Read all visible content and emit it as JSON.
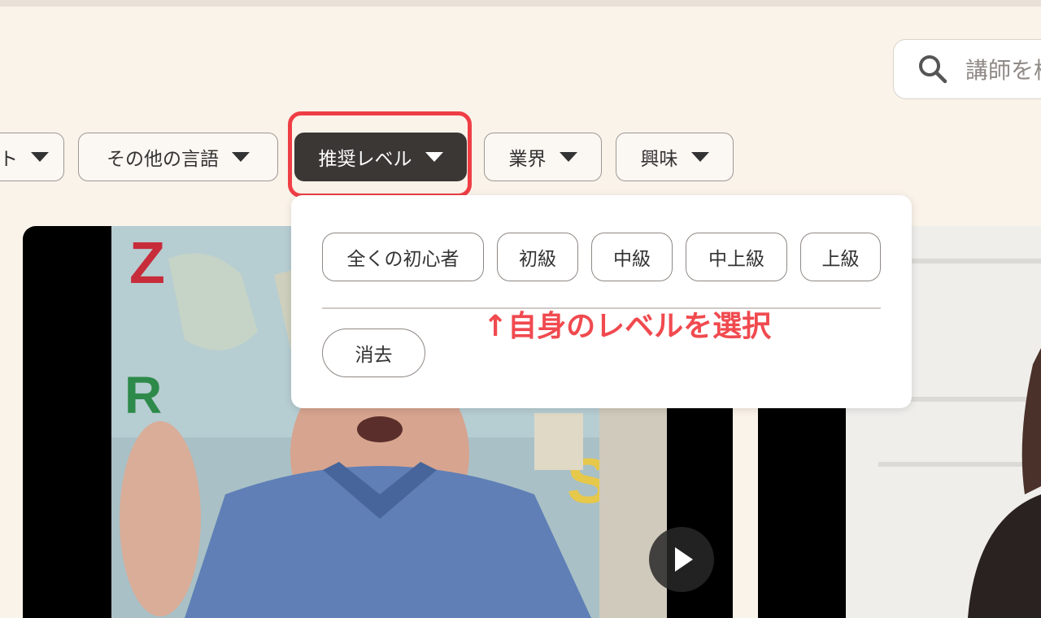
{
  "search": {
    "placeholder": "講師を検"
  },
  "filters": [
    {
      "label": "ト",
      "active": false
    },
    {
      "label": "その他の言語",
      "active": false
    },
    {
      "label": "推奨レベル",
      "active": true
    },
    {
      "label": "業界",
      "active": false
    },
    {
      "label": "興味",
      "active": false
    }
  ],
  "level_dropdown": {
    "options": [
      "全くの初心者",
      "初級",
      "中級",
      "中上級",
      "上級"
    ],
    "clear_label": "消去"
  },
  "annotation": {
    "text": "↑自身のレベルを選択",
    "color": "#f04a4f"
  },
  "colors": {
    "background": "#faf3ea",
    "active_filter": "#3b3735",
    "highlight": "#ef3e45"
  },
  "icons": {
    "search": "search-icon",
    "play": "play-icon",
    "caret": "caret-down-icon"
  }
}
